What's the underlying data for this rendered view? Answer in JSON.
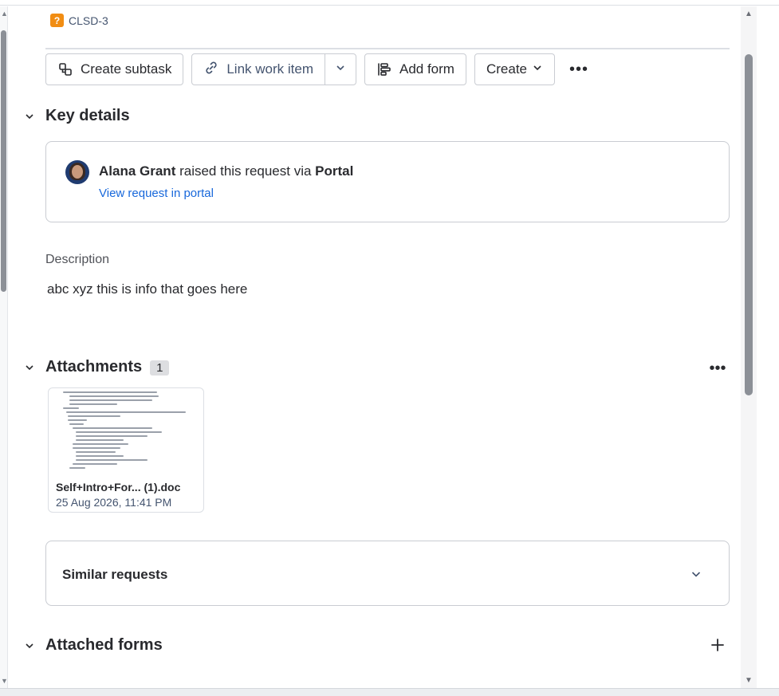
{
  "issue": {
    "key": "CLSD-3",
    "type_icon": "question-mark-icon"
  },
  "toolbar": {
    "create_subtask": "Create subtask",
    "link_work_item": "Link work item",
    "add_form": "Add form",
    "create": "Create",
    "more": "•••"
  },
  "key_details": {
    "title": "Key details",
    "requester_name": "Alana Grant",
    "raised_text": " raised this request via ",
    "channel": "Portal",
    "view_link": "View request in portal"
  },
  "description": {
    "label": "Description",
    "text": "abc xyz this is info that goes here"
  },
  "attachments": {
    "title": "Attachments",
    "count": "1",
    "more": "•••",
    "items": [
      {
        "name": "Self+Intro+For... (1).doc",
        "date": "25 Aug 2026, 11:41 PM"
      }
    ]
  },
  "similar_requests": {
    "title": "Similar requests"
  },
  "attached_forms": {
    "title": "Attached forms"
  },
  "colors": {
    "link": "#1868db",
    "badge_bg": "#dddee1",
    "issue_icon": "#f18d13"
  }
}
